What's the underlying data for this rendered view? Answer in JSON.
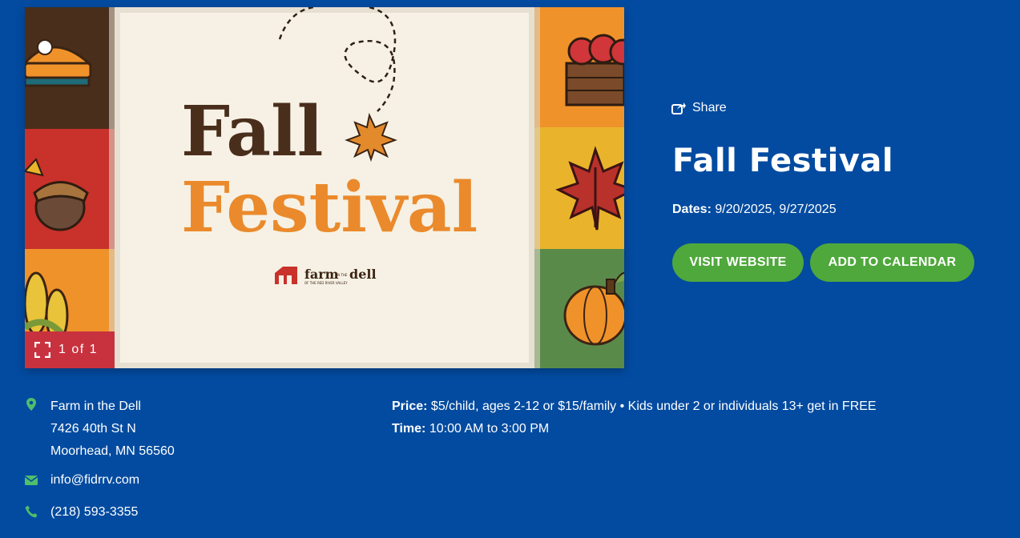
{
  "gallery": {
    "image_alt": "Fall Festival farm in the dell",
    "headline_line1": "Fall",
    "headline_line2": "Festival",
    "logo_text": "farm",
    "logo_small": "IN THE",
    "logo_text2": "dell",
    "logo_sub": "OF THE RED RIVER VALLEY",
    "counter": "1 of 1"
  },
  "event": {
    "share_label": "Share",
    "title": "Fall Festival",
    "dates_label": "Dates:",
    "dates_value": " 9/20/2025, 9/27/2025",
    "visit_button": "VISIT WEBSITE",
    "calendar_button": "ADD TO CALENDAR"
  },
  "location": {
    "name": "Farm in the Dell",
    "street": "7426 40th St N",
    "city": "Moorhead, MN 56560",
    "email": "info@fidrrv.com",
    "phone": "(218) 593-3355"
  },
  "details": {
    "price_label": "Price:",
    "price_value": " $5/child, ages 2-12 or $15/family • Kids under 2 or individuals 13+ get in FREE",
    "time_label": "Time:",
    "time_value": " 10:00 AM to 3:00 PM"
  },
  "colors": {
    "background": "#034ba0",
    "button_green": "#4fa83b",
    "counter_red": "#c8323f",
    "icon_green": "#4fbf6b"
  }
}
